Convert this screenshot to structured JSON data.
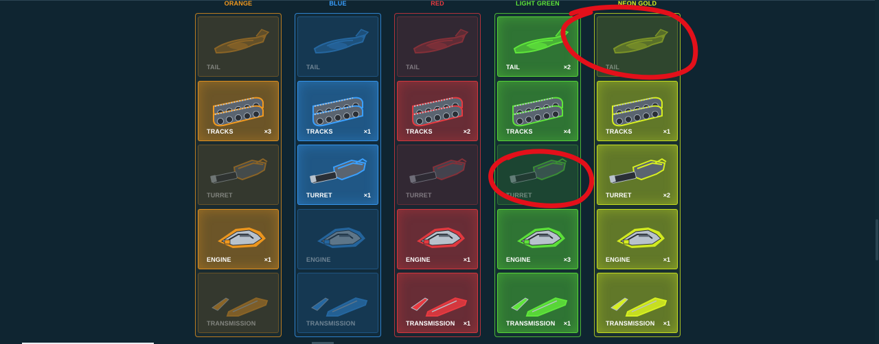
{
  "columns": [
    {
      "title": "ORANGE",
      "accent": "#f39a1e",
      "cells": [
        {
          "label": "TAIL",
          "qty": "",
          "owned": false
        },
        {
          "label": "TRACKS",
          "qty": "×3",
          "owned": true
        },
        {
          "label": "TURRET",
          "qty": "",
          "owned": false
        },
        {
          "label": "ENGINE",
          "qty": "×1",
          "owned": true
        },
        {
          "label": "TRANSMISSION",
          "qty": "",
          "owned": false
        }
      ]
    },
    {
      "title": "BLUE",
      "accent": "#3aa0ff",
      "cells": [
        {
          "label": "TAIL",
          "qty": "",
          "owned": false
        },
        {
          "label": "TRACKS",
          "qty": "×1",
          "owned": true
        },
        {
          "label": "TURRET",
          "qty": "×1",
          "owned": true
        },
        {
          "label": "ENGINE",
          "qty": "",
          "owned": false
        },
        {
          "label": "TRANSMISSION",
          "qty": "",
          "owned": false
        }
      ]
    },
    {
      "title": "RED",
      "accent": "#e83a40",
      "cells": [
        {
          "label": "TAIL",
          "qty": "",
          "owned": false
        },
        {
          "label": "TRACKS",
          "qty": "×2",
          "owned": true
        },
        {
          "label": "TURRET",
          "qty": "",
          "owned": false
        },
        {
          "label": "ENGINE",
          "qty": "×1",
          "owned": true
        },
        {
          "label": "TRANSMISSION",
          "qty": "×1",
          "owned": true
        }
      ]
    },
    {
      "title": "LIGHT GREEN",
      "accent": "#5fe63a",
      "cells": [
        {
          "label": "TAIL",
          "qty": "×2",
          "owned": true
        },
        {
          "label": "TRACKS",
          "qty": "×4",
          "owned": true
        },
        {
          "label": "TURRET",
          "qty": "",
          "owned": false
        },
        {
          "label": "ENGINE",
          "qty": "×3",
          "owned": true
        },
        {
          "label": "TRANSMISSION",
          "qty": "×1",
          "owned": true
        }
      ]
    },
    {
      "title": "NEON GOLD",
      "accent": "#d8f020",
      "cells": [
        {
          "label": "TAIL",
          "qty": "",
          "owned": false
        },
        {
          "label": "TRACKS",
          "qty": "×1",
          "owned": true
        },
        {
          "label": "TURRET",
          "qty": "×2",
          "owned": true
        },
        {
          "label": "ENGINE",
          "qty": "×1",
          "owned": true
        },
        {
          "label": "TRANSMISSION",
          "qty": "×1",
          "owned": true
        }
      ]
    }
  ],
  "annotations": {
    "color": "#e3101a",
    "marks": [
      "circle-neon-gold-tail",
      "circle-light-green-turret"
    ]
  }
}
